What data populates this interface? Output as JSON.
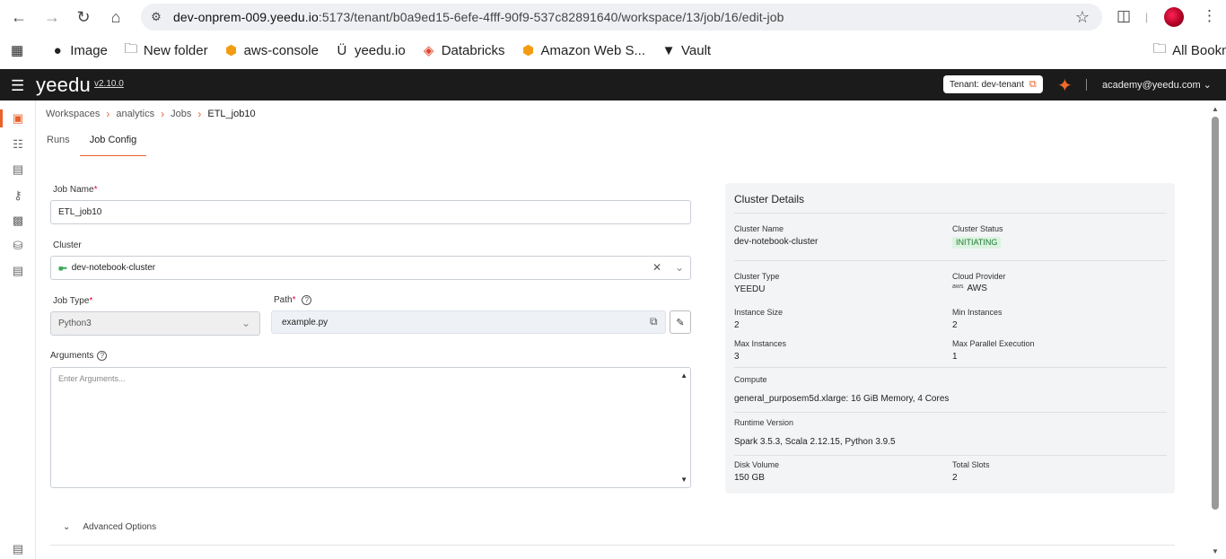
{
  "browser": {
    "url_host": "dev-onprem-009.yeedu.io",
    "url_path": ":5173/tenant/b0a9ed15-6efe-4fff-90f9-537c82891640/workspace/13/job/16/edit-job",
    "bookmarks": [
      {
        "label": "Image",
        "icon": "globe-icon"
      },
      {
        "label": "New folder",
        "icon": "folder-icon"
      },
      {
        "label": "aws-console",
        "icon": "aws-cube-icon"
      },
      {
        "label": "yeedu.io",
        "icon": "yeedu-icon"
      },
      {
        "label": "Databricks",
        "icon": "databricks-icon"
      },
      {
        "label": "Amazon Web S...",
        "icon": "aws-cube-icon"
      },
      {
        "label": "Vault",
        "icon": "vault-icon"
      }
    ],
    "all_bookmarks": "All Bookmarks"
  },
  "app": {
    "logo": "yeedu",
    "version": "v2.10.0",
    "tenant_label": "Tenant:",
    "tenant_value": "dev-tenant",
    "user_email": "academy@yeedu.com"
  },
  "breadcrumb": {
    "items": [
      "Workspaces",
      "analytics",
      "Jobs"
    ],
    "current": "ETL_job10"
  },
  "tabs": {
    "runs": "Runs",
    "job_config": "Job Config"
  },
  "form": {
    "job_name_label": "Job Name",
    "job_name_value": "ETL_job10",
    "cluster_label": "Cluster",
    "cluster_value": "dev-notebook-cluster",
    "job_type_label": "Job Type",
    "job_type_value": "Python3",
    "path_label": "Path",
    "path_value": "example.py",
    "arguments_label": "Arguments",
    "arguments_placeholder": "Enter Arguments...",
    "required_mark": "*",
    "advanced_options": "Advanced Options"
  },
  "cluster_details": {
    "title": "Cluster Details",
    "cluster_name_label": "Cluster Name",
    "cluster_name": "dev-notebook-cluster",
    "cluster_status_label": "Cluster Status",
    "cluster_status": "INITIATING",
    "cluster_type_label": "Cluster Type",
    "cluster_type": "YEEDU",
    "cloud_provider_label": "Cloud Provider",
    "cloud_provider": "AWS",
    "cloud_provider_logo": "aws",
    "instance_size_label": "Instance Size",
    "instance_size": "2",
    "min_instances_label": "Min Instances",
    "min_instances": "2",
    "max_instances_label": "Max Instances",
    "max_instances": "3",
    "max_parallel_label": "Max Parallel Execution",
    "max_parallel": "1",
    "compute_label": "Compute",
    "compute": "general_purposem5d.xlarge:  16 GiB Memory,  4 Cores",
    "runtime_label": "Runtime Version",
    "runtime": "Spark 3.5.3, Scala 2.12.15, Python 3.9.5",
    "disk_label": "Disk Volume",
    "disk": "150 GB",
    "slots_label": "Total Slots",
    "slots": "2"
  },
  "colors": {
    "accent": "#e8622a",
    "header_bg": "#1b1b1b",
    "status_bg": "#dbf3df",
    "status_fg": "#1c7a33"
  }
}
